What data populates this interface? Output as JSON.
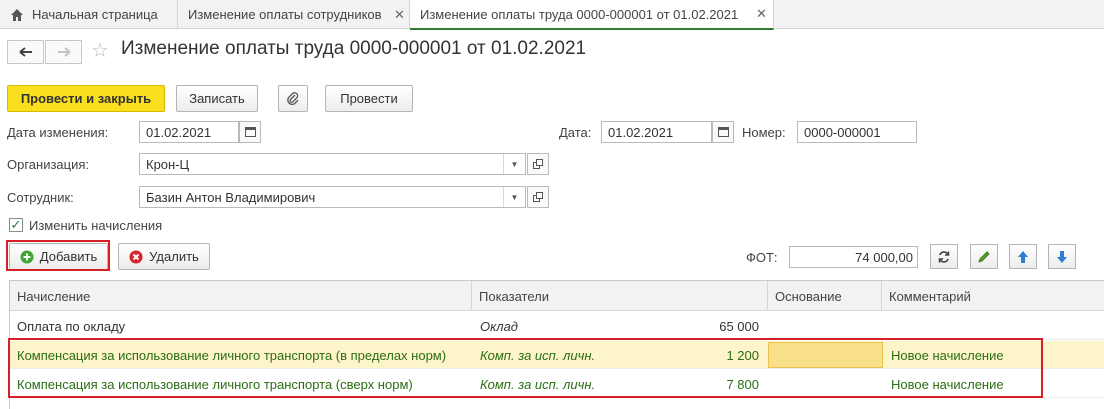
{
  "tabs": [
    {
      "label": "Начальная страница"
    },
    {
      "label": "Изменение оплаты сотрудников"
    },
    {
      "label": "Изменение оплаты труда 0000-000001 от 01.02.2021"
    }
  ],
  "header": {
    "title": "Изменение оплаты труда 0000-000001 от 01.02.2021"
  },
  "toolbar": {
    "post_close": "Провести и закрыть",
    "save": "Записать",
    "post": "Провести"
  },
  "form": {
    "change_date_label": "Дата изменения:",
    "change_date_value": "01.02.2021",
    "date_label": "Дата:",
    "date_value": "01.02.2021",
    "number_label": "Номер:",
    "number_value": "0000-000001",
    "org_label": "Организация:",
    "org_value": "Крон-Ц",
    "employee_label": "Сотрудник:",
    "employee_value": "Базин Антон Владимирович",
    "change_accruals_label": "Изменить начисления",
    "change_accruals_checked": true
  },
  "table_toolbar": {
    "add": "Добавить",
    "delete": "Удалить",
    "fot_label": "ФОТ:",
    "fot_value": "74 000,00"
  },
  "table": {
    "columns": [
      "Начисление",
      "Показатели",
      "Основание",
      "Комментарий"
    ],
    "rows": [
      {
        "accrual": "Оплата по окладу",
        "indicator": "Оклад",
        "value": "65 000",
        "basis": "",
        "comment": ""
      },
      {
        "accrual": "Компенсация за использование личного транспорта (в пределах норм)",
        "indicator": "Комп. за исп. личн.",
        "value": "1 200",
        "basis": "",
        "comment": "Новое начисление"
      },
      {
        "accrual": "Компенсация за использование личного транспорта (сверх норм)",
        "indicator": "Комп. за исп. личн.",
        "value": "7 800",
        "basis": "",
        "comment": "Новое начисление"
      }
    ]
  },
  "colors": {
    "accent_green": "#2e7d32",
    "primary_yellow": "#f9df1c",
    "highlight_red": "#d61f26",
    "selected_row": "#fdf4c9"
  }
}
